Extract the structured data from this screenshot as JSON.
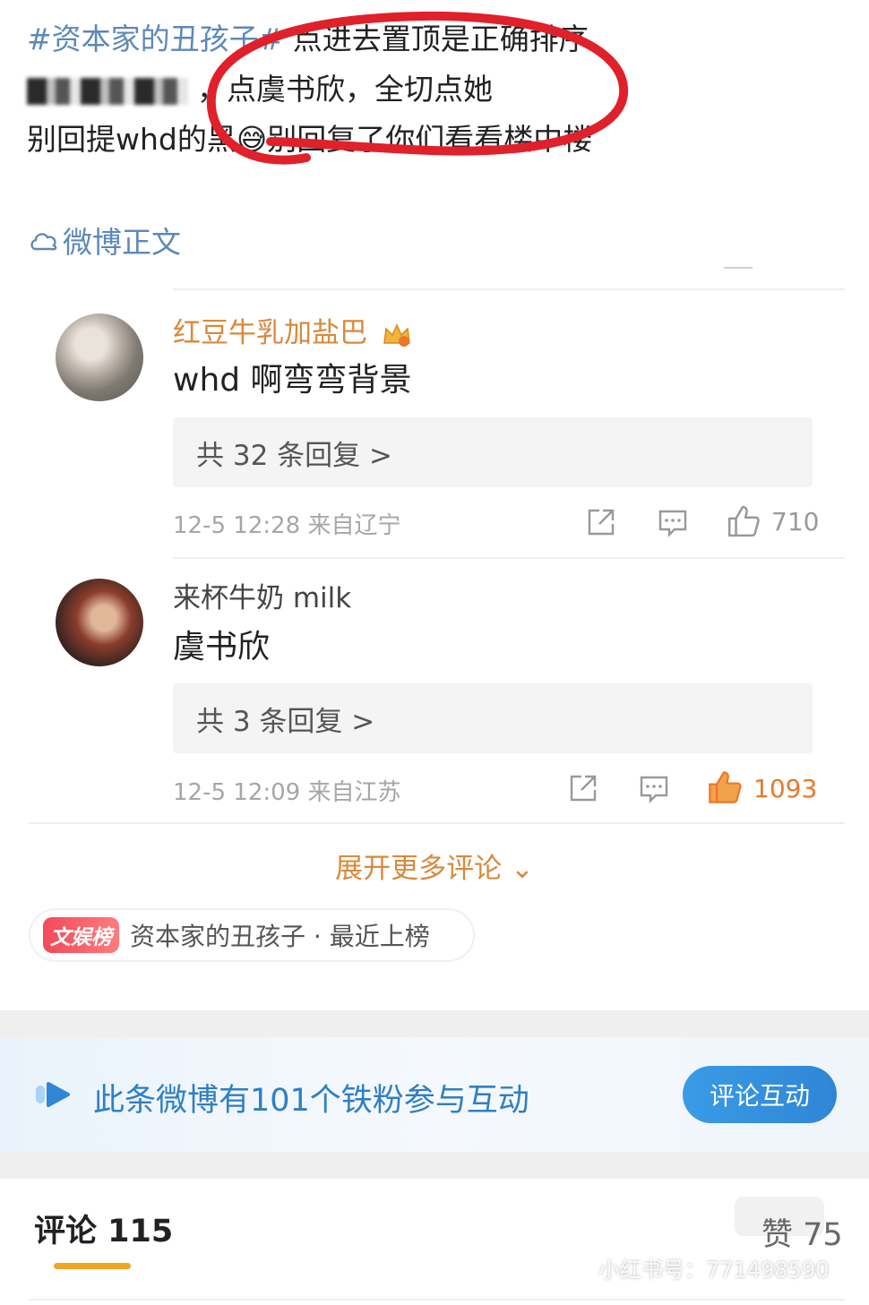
{
  "post": {
    "line1_tag": "#资本家的丑孩子#",
    "line1_rest": " 点进去置顶是正确排序",
    "line2": "，点虞书欣，全切点她",
    "line3": "别回提whd的黑😅别回复了你们看看楼中楼"
  },
  "weibo_link": "微博正文",
  "comments": [
    {
      "username": "红豆牛乳加盐巴",
      "text": "whd 啊弯弯背景",
      "replies": "共 32 条回复 >",
      "meta": "12-5 12:28  来自辽宁",
      "likes": "710",
      "liked": false
    },
    {
      "username": "来杯牛奶 milk",
      "text": "虞书欣",
      "replies": "共 3 条回复 >",
      "meta": "12-5 12:09  来自江苏",
      "likes": "1093",
      "liked": true
    }
  ],
  "expand_more": "展开更多评论 ⌄",
  "rank": {
    "badge": "文娱榜",
    "text": "资本家的丑孩子 · 最近上榜"
  },
  "fans_banner": {
    "text": "此条微博有101个铁粉参与互动",
    "button": "评论互动"
  },
  "tabs": {
    "comments": "评论 115",
    "likes": "赞 75"
  },
  "watermark": "小红书号：771498590",
  "colors": {
    "accent_orange": "#d8893b",
    "link_blue": "#5d88b8",
    "banner_blue": "#2f7fc4",
    "annotation_red": "#e0202a"
  }
}
